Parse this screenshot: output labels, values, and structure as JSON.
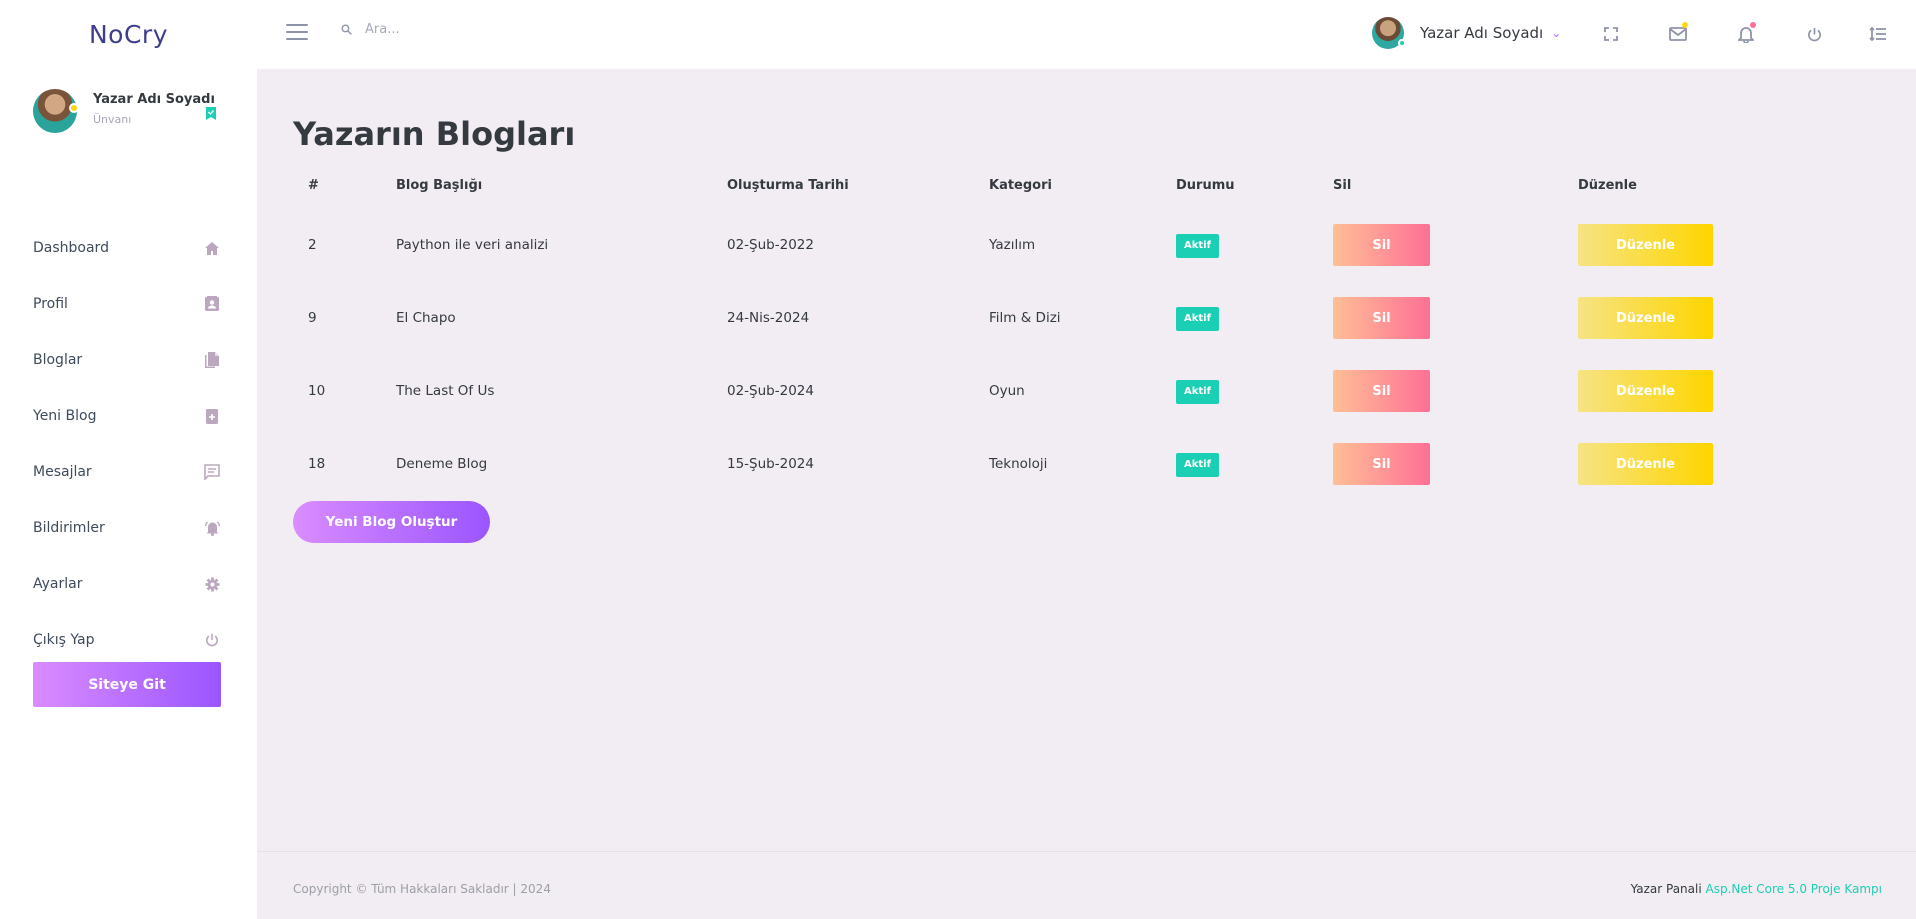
{
  "brand": {
    "name": "NoCry"
  },
  "search": {
    "placeholder": "Ara..."
  },
  "topbar": {
    "user_name": "Yazar Adı Soyadı",
    "mail_dot_color": "#fed713",
    "bell_dot_color": "#fe7096"
  },
  "sidebar": {
    "profile": {
      "name": "Yazar Adı Soyadı",
      "title": "Ünvanı"
    },
    "items": [
      {
        "label": "Dashboard",
        "icon": "home-icon"
      },
      {
        "label": "Profil",
        "icon": "contact-card-icon"
      },
      {
        "label": "Bloglar",
        "icon": "document-icon"
      },
      {
        "label": "Yeni Blog",
        "icon": "book-plus-icon"
      },
      {
        "label": "Mesajlar",
        "icon": "message-icon"
      },
      {
        "label": "Bildirimler",
        "icon": "bell-ring-icon"
      },
      {
        "label": "Ayarlar",
        "icon": "gear-icon"
      },
      {
        "label": "Çıkış Yap",
        "icon": "power-icon"
      }
    ],
    "site_button": "Siteye Git"
  },
  "main": {
    "title": "Yazarın Blogları",
    "columns": [
      "#",
      "Blog Başlığı",
      "Oluşturma Tarihi",
      "Kategori",
      "Durumu",
      "Sil",
      "Düzenle"
    ],
    "rows": [
      {
        "id": "2",
        "title": "Paython ile veri analizi",
        "date": "02-Şub-2022",
        "category": "Yazılım",
        "status": "Aktif",
        "delete": "Sil",
        "edit": "Düzenle"
      },
      {
        "id": "9",
        "title": "El Chapo",
        "date": "24-Nis-2024",
        "category": "Film & Dizi",
        "status": "Aktif",
        "delete": "Sil",
        "edit": "Düzenle"
      },
      {
        "id": "10",
        "title": "The Last Of Us",
        "date": "02-Şub-2024",
        "category": "Oyun",
        "status": "Aktif",
        "delete": "Sil",
        "edit": "Düzenle"
      },
      {
        "id": "18",
        "title": "Deneme Blog",
        "date": "15-Şub-2024",
        "category": "Teknoloji",
        "status": "Aktif",
        "delete": "Sil",
        "edit": "Düzenle"
      }
    ],
    "new_button": "Yeni Blog Oluştur"
  },
  "footer": {
    "copyright": "Copyright © Tüm Hakkaları Sakladır | 2024",
    "panel_label": "Yazar Panali",
    "panel_link": "Asp.Net Core 5.0 Proje Kampı"
  },
  "colors": {
    "accent": "#9a55ff",
    "success": "#1bcfb4",
    "danger": "#fe7096",
    "warning": "#ffd500"
  }
}
